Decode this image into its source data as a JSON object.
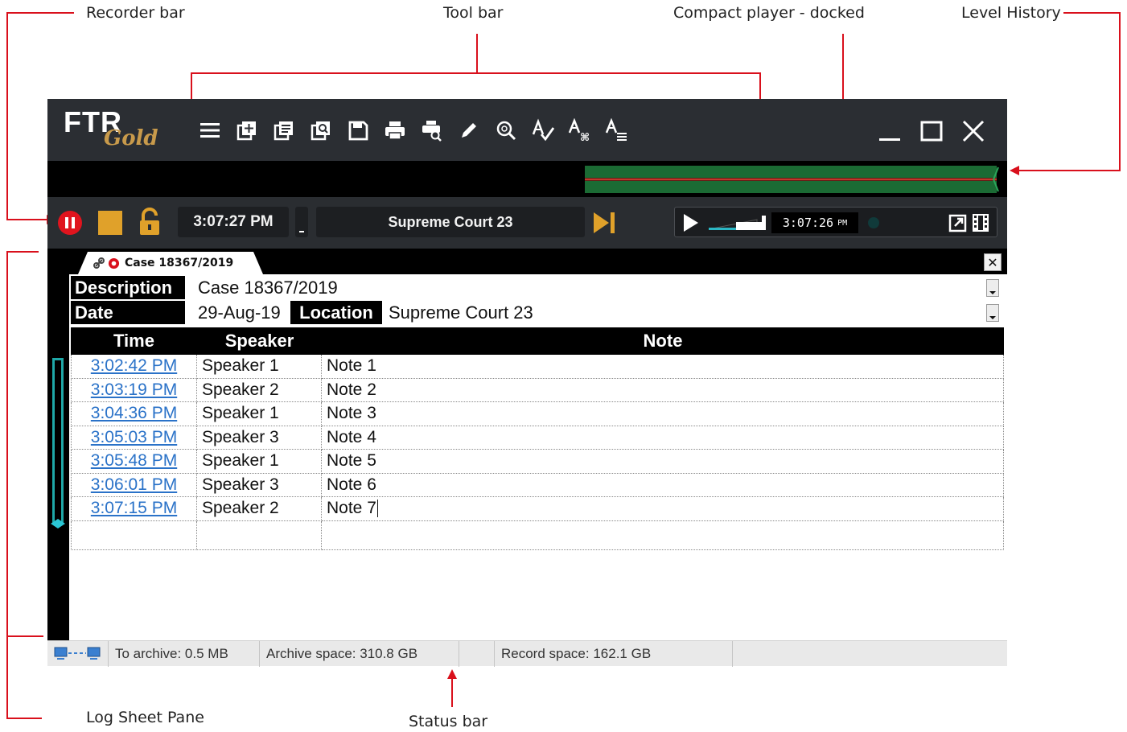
{
  "callouts": {
    "recorder_bar": "Recorder bar",
    "tool_bar": "Tool bar",
    "compact_player": "Compact player - docked",
    "level_history": "Level History",
    "log_sheet_pane": "Log Sheet Pane",
    "status_bar": "Status bar"
  },
  "colors": {
    "callout_line": "#d9101c",
    "title_bg": "#2b2e33",
    "logo_gold": "#c89a4b",
    "record_red": "#e0141e",
    "accent_gold": "#e0a12a",
    "level_green": "#1b6b34",
    "level_red": "#c0392b",
    "link_blue": "#2a72c8"
  },
  "logo": {
    "main": "FTR",
    "sub": "Gold"
  },
  "toolbar_icons": [
    "menu-icon",
    "new-logsheet-icon",
    "logsheet-list-icon",
    "preview-icon",
    "save-icon",
    "print-icon",
    "print-preview-icon",
    "pen-icon",
    "search-icon",
    "spellcheck-icon",
    "replace-text-icon",
    "text-list-icon"
  ],
  "window_icons": [
    "minimize-icon",
    "maximize-icon",
    "close-icon"
  ],
  "recorder": {
    "current_time": "3:07:27 PM",
    "location": "Supreme Court 23"
  },
  "player": {
    "time": "3:07:26",
    "ampm": "PM"
  },
  "tab": {
    "label": "Case 18367/2019"
  },
  "logsheet": {
    "description_label": "Description",
    "description_value": "Case 18367/2019",
    "date_label": "Date",
    "date_value": "29-Aug-19",
    "location_label": "Location",
    "location_value": "Supreme Court 23",
    "columns": [
      "Time",
      "Speaker",
      "Note"
    ],
    "rows": [
      {
        "time": "3:02:42 PM",
        "speaker": "Speaker 1",
        "note": "Note 1"
      },
      {
        "time": "3:03:19 PM",
        "speaker": "Speaker 2",
        "note": "Note 2"
      },
      {
        "time": "3:04:36 PM",
        "speaker": "Speaker 1",
        "note": "Note 3"
      },
      {
        "time": "3:05:03 PM",
        "speaker": "Speaker 3",
        "note": "Note 4"
      },
      {
        "time": "3:05:48 PM",
        "speaker": "Speaker 1",
        "note": "Note 5"
      },
      {
        "time": "3:06:01 PM",
        "speaker": "Speaker 3",
        "note": "Note 6"
      },
      {
        "time": "3:07:15 PM",
        "speaker": "Speaker 2",
        "note": "Note 7"
      }
    ]
  },
  "status": {
    "to_archive": "To archive: 0.5 MB",
    "archive_space": "Archive space: 310.8 GB",
    "record_space": "Record space: 162.1 GB"
  }
}
